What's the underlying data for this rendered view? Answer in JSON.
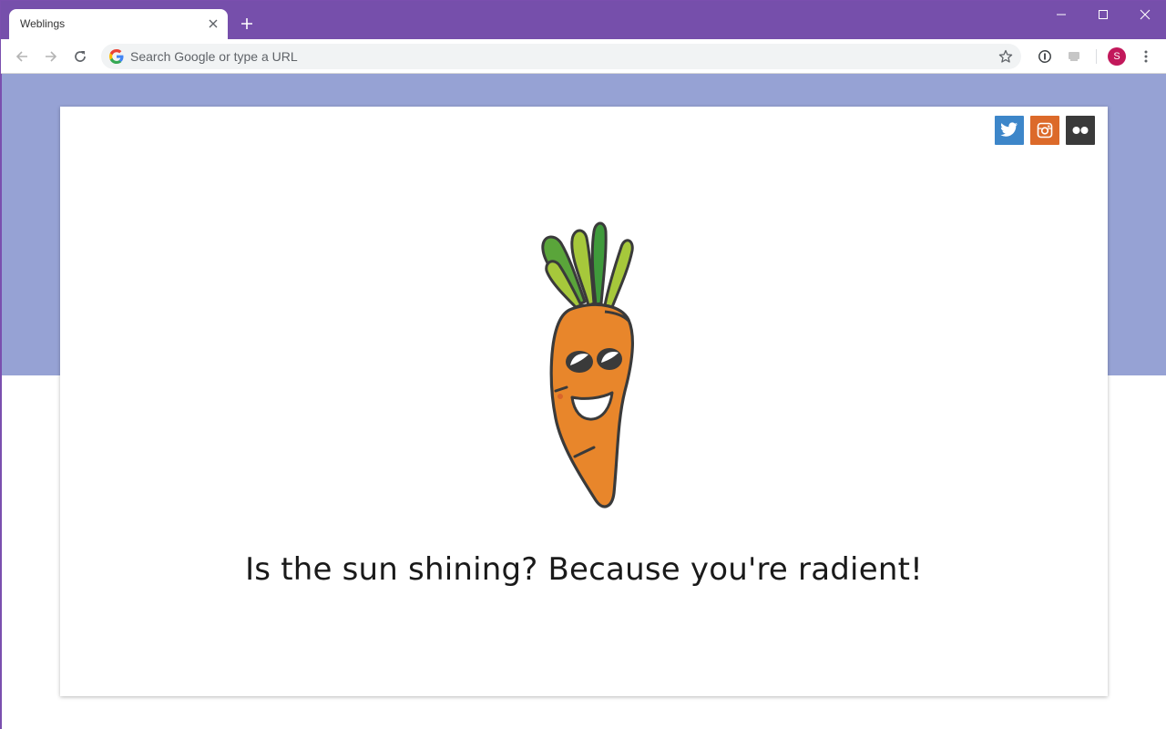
{
  "browser": {
    "tab": {
      "title": "Weblings"
    },
    "omnibox": {
      "placeholder": "Search Google or type a URL",
      "value": ""
    },
    "profile": {
      "initial": "S"
    }
  },
  "page": {
    "message": "Is the sun shining? Because you're radient!",
    "social": [
      {
        "name": "twitter",
        "color": "#3d86c9"
      },
      {
        "name": "instagram",
        "color": "#dc6a2a"
      },
      {
        "name": "flickr",
        "color": "#3a3a3a"
      }
    ]
  },
  "colors": {
    "chrome_frame": "#764fab",
    "banner": "#96a2d4",
    "carrot": "#e8862b"
  }
}
